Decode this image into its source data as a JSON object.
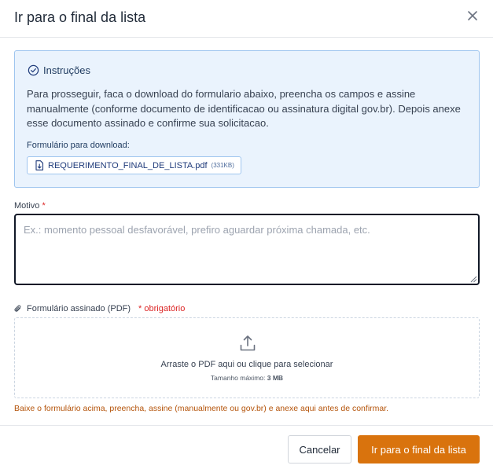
{
  "dialog": {
    "title": "Ir para o final da lista",
    "close_icon": "close-icon"
  },
  "instructions": {
    "icon": "check-circle-icon",
    "title": "Instruções",
    "text": "Para prosseguir, faca o download do formulario abaixo, preencha os campos e assine manualmente (conforme documento de identificacao ou assinatura digital gov.br). Depois anexe esse documento assinado e confirme sua solicitacao.",
    "download_label": "Formulário para download:",
    "file": {
      "icon": "file-download-icon",
      "name": "REQUERIMENTO_FINAL_DE_LISTA.pdf",
      "size": "(331KB)"
    }
  },
  "motivo": {
    "label": "Motivo",
    "required_mark": "*",
    "value": "",
    "placeholder": "Ex.: momento pessoal desfavorável, prefiro aguardar próxima chamada, etc."
  },
  "upload": {
    "icon": "paperclip-icon",
    "label": "Formulário assinado (PDF)",
    "required_text": "* obrigatório",
    "dropzone_icon": "upload-icon",
    "dropzone_text": "Arraste o PDF aqui ou clique para selecionar",
    "max_size_label": "Tamanho máximo:",
    "max_size_value": "3 MB",
    "hint": "Baixe o formulário acima, preencha, assine (manualmente ou gov.br) e anexe aqui antes de confirmar."
  },
  "footer": {
    "cancel_label": "Cancelar",
    "confirm_label": "Ir para o final da lista"
  },
  "colors": {
    "accent": "#d9730d",
    "info_bg": "#eaf3fd",
    "info_border": "#9fc5ef",
    "required": "#dc2626",
    "hint": "#b45309"
  }
}
